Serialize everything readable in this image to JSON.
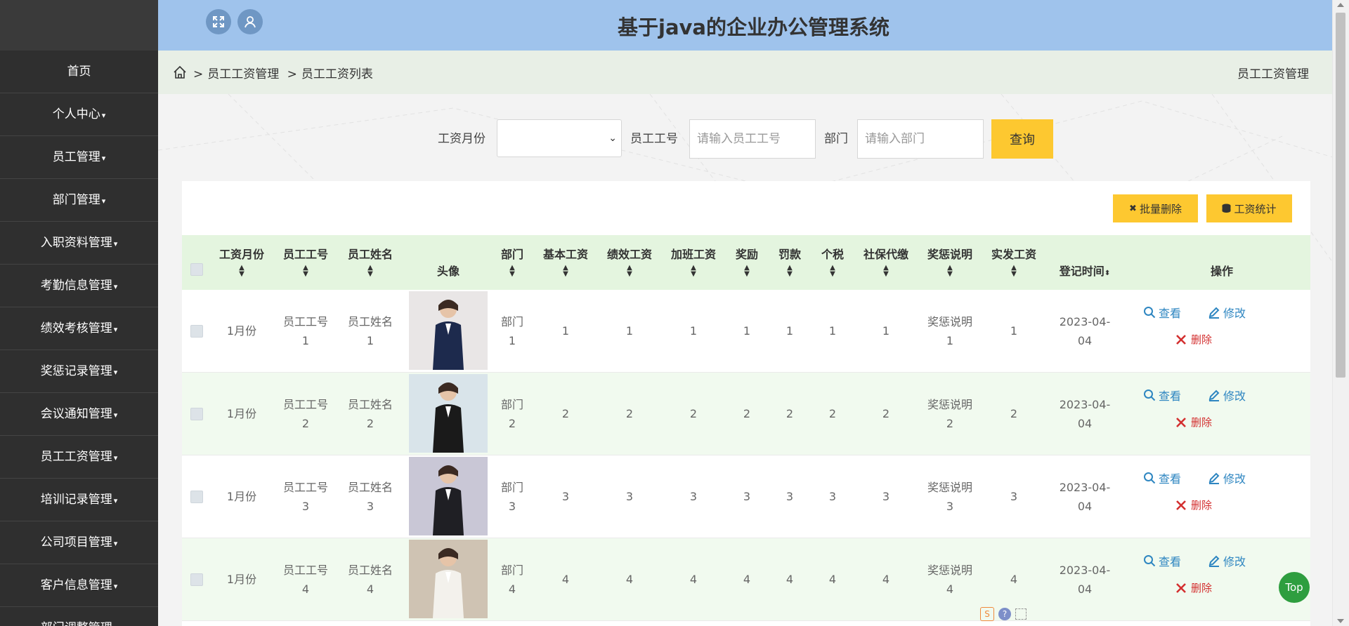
{
  "header": {
    "title": "基于java的企业办公管理系统"
  },
  "sidebar": {
    "items": [
      {
        "label": "首页",
        "has_caret": false
      },
      {
        "label": "个人中心",
        "has_caret": true
      },
      {
        "label": "员工管理",
        "has_caret": true
      },
      {
        "label": "部门管理",
        "has_caret": true
      },
      {
        "label": "入职资料管理",
        "has_caret": true
      },
      {
        "label": "考勤信息管理",
        "has_caret": true
      },
      {
        "label": "绩效考核管理",
        "has_caret": true
      },
      {
        "label": "奖惩记录管理",
        "has_caret": true
      },
      {
        "label": "会议通知管理",
        "has_caret": true
      },
      {
        "label": "员工工资管理",
        "has_caret": true
      },
      {
        "label": "培训记录管理",
        "has_caret": true
      },
      {
        "label": "公司项目管理",
        "has_caret": true
      },
      {
        "label": "客户信息管理",
        "has_caret": true
      },
      {
        "label": "部门调整管理",
        "has_caret": true
      }
    ],
    "caret": "▾"
  },
  "breadcrumb": {
    "sep": ">",
    "level1": "员工工资管理",
    "level2": "员工工资列表",
    "right": "员工工资管理"
  },
  "search": {
    "month_label": "工资月份",
    "month_value": "",
    "empno_label": "员工工号",
    "empno_placeholder": "请输入员工工号",
    "dept_label": "部门",
    "dept_placeholder": "请输入部门",
    "button": "查询"
  },
  "toolbar": {
    "batch_delete": "批量删除",
    "stats": "工资统计"
  },
  "table": {
    "headers": {
      "month": "工资月份",
      "empno": "员工工号",
      "name": "员工姓名",
      "avatar": "头像",
      "dept": "部门",
      "base": "基本工资",
      "perf": "绩效工资",
      "overtime": "加班工资",
      "bonus": "奖励",
      "fine": "罚款",
      "tax": "个税",
      "social": "社保代缴",
      "note": "奖惩说明",
      "net": "实发工资",
      "date": "登记时间",
      "ops": "操作"
    },
    "sort_glyph": "▲▼",
    "rows": [
      {
        "month": "1月份",
        "empno_a": "员工工号",
        "empno_b": "1",
        "name_a": "员工姓名",
        "name_b": "1",
        "dept_a": "部门",
        "dept_b": "1",
        "base": "1",
        "perf": "1",
        "overtime": "1",
        "bonus": "1",
        "fine": "1",
        "tax": "1",
        "social": "1",
        "note_a": "奖惩说明",
        "note_b": "1",
        "net": "1",
        "date_a": "2023-04-",
        "date_b": "04"
      },
      {
        "month": "1月份",
        "empno_a": "员工工号",
        "empno_b": "2",
        "name_a": "员工姓名",
        "name_b": "2",
        "dept_a": "部门",
        "dept_b": "2",
        "base": "2",
        "perf": "2",
        "overtime": "2",
        "bonus": "2",
        "fine": "2",
        "tax": "2",
        "social": "2",
        "note_a": "奖惩说明",
        "note_b": "2",
        "net": "2",
        "date_a": "2023-04-",
        "date_b": "04"
      },
      {
        "month": "1月份",
        "empno_a": "员工工号",
        "empno_b": "3",
        "name_a": "员工姓名",
        "name_b": "3",
        "dept_a": "部门",
        "dept_b": "3",
        "base": "3",
        "perf": "3",
        "overtime": "3",
        "bonus": "3",
        "fine": "3",
        "tax": "3",
        "social": "3",
        "note_a": "奖惩说明",
        "note_b": "3",
        "net": "3",
        "date_a": "2023-04-",
        "date_b": "04"
      },
      {
        "month": "1月份",
        "empno_a": "员工工号",
        "empno_b": "4",
        "name_a": "员工姓名",
        "name_b": "4",
        "dept_a": "部门",
        "dept_b": "4",
        "base": "4",
        "perf": "4",
        "overtime": "4",
        "bonus": "4",
        "fine": "4",
        "tax": "4",
        "social": "4",
        "note_a": "奖惩说明",
        "note_b": "4",
        "net": "4",
        "date_a": "2023-04-",
        "date_b": "04"
      }
    ],
    "actions": {
      "view": "查看",
      "edit": "修改",
      "delete": "删除"
    }
  },
  "top_button": "Top",
  "colors": {
    "header": "#9fc3ec",
    "sidebar": "#2f2f2f",
    "accent": "#fdc830",
    "table_head": "#e4f5df",
    "link": "#2e86c1",
    "danger": "#d32f2f",
    "top_btn": "#2e9e3f"
  }
}
